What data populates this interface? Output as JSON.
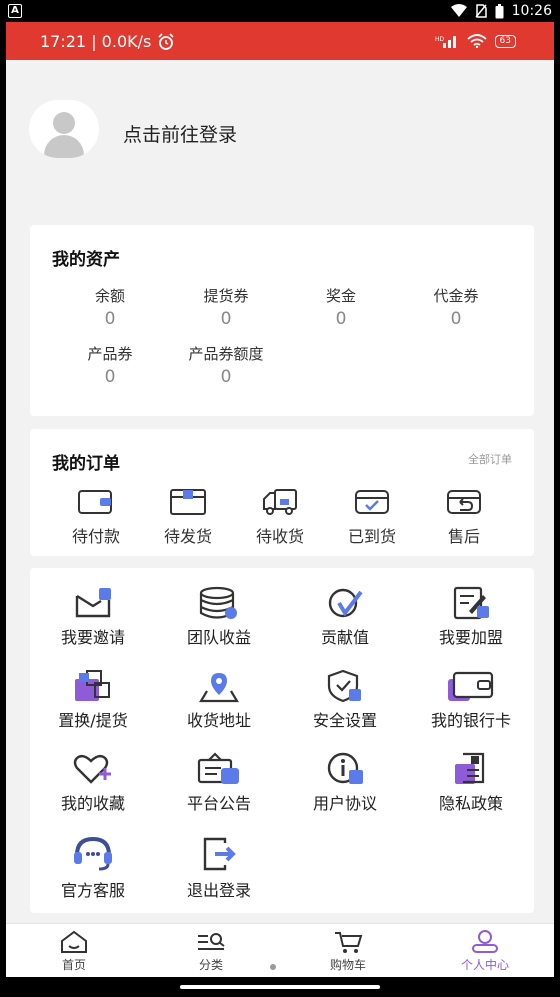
{
  "outer_status": {
    "time": "10:26"
  },
  "inner_status": {
    "time_speed": "17:21 | 0.0K/s",
    "battery": "63"
  },
  "login": {
    "prompt": "点击前往登录"
  },
  "assets": {
    "title": "我的资产",
    "items": [
      {
        "label": "余额",
        "value": "0"
      },
      {
        "label": "提货券",
        "value": "0"
      },
      {
        "label": "奖金",
        "value": "0"
      },
      {
        "label": "代金券",
        "value": "0"
      },
      {
        "label": "产品券",
        "value": "0"
      },
      {
        "label": "产品券额度",
        "value": "0"
      }
    ]
  },
  "orders": {
    "title": "我的订单",
    "all_label": "全部订单",
    "items": [
      {
        "label": "待付款",
        "icon": "wallet-icon"
      },
      {
        "label": "待发货",
        "icon": "box-icon"
      },
      {
        "label": "待收货",
        "icon": "truck-icon"
      },
      {
        "label": "已到货",
        "icon": "arrived-box-icon"
      },
      {
        "label": "售后",
        "icon": "return-icon"
      }
    ]
  },
  "services": {
    "items": [
      {
        "label": "我要邀请",
        "icon": "invite-icon"
      },
      {
        "label": "团队收益",
        "icon": "coins-icon"
      },
      {
        "label": "贡献值",
        "icon": "contribution-icon"
      },
      {
        "label": "我要加盟",
        "icon": "join-icon"
      },
      {
        "label": "置换/提货",
        "icon": "exchange-icon"
      },
      {
        "label": "收货地址",
        "icon": "location-icon"
      },
      {
        "label": "安全设置",
        "icon": "shield-icon"
      },
      {
        "label": "我的银行卡",
        "icon": "bank-card-icon"
      },
      {
        "label": "我的收藏",
        "icon": "heart-icon"
      },
      {
        "label": "平台公告",
        "icon": "notice-icon"
      },
      {
        "label": "用户协议",
        "icon": "info-icon"
      },
      {
        "label": "隐私政策",
        "icon": "privacy-icon"
      },
      {
        "label": "官方客服",
        "icon": "headset-icon"
      },
      {
        "label": "退出登录",
        "icon": "logout-icon"
      }
    ]
  },
  "tabbar": {
    "items": [
      {
        "label": "首页",
        "icon": "home-icon"
      },
      {
        "label": "分类",
        "icon": "category-icon"
      },
      {
        "label": "购物车",
        "icon": "cart-icon"
      },
      {
        "label": "个人中心",
        "icon": "user-icon",
        "active": true
      }
    ]
  },
  "colors": {
    "header_red": "#E0392F",
    "accent_purple": "#8E5BD9",
    "icon_blue": "#5B7BEA"
  }
}
